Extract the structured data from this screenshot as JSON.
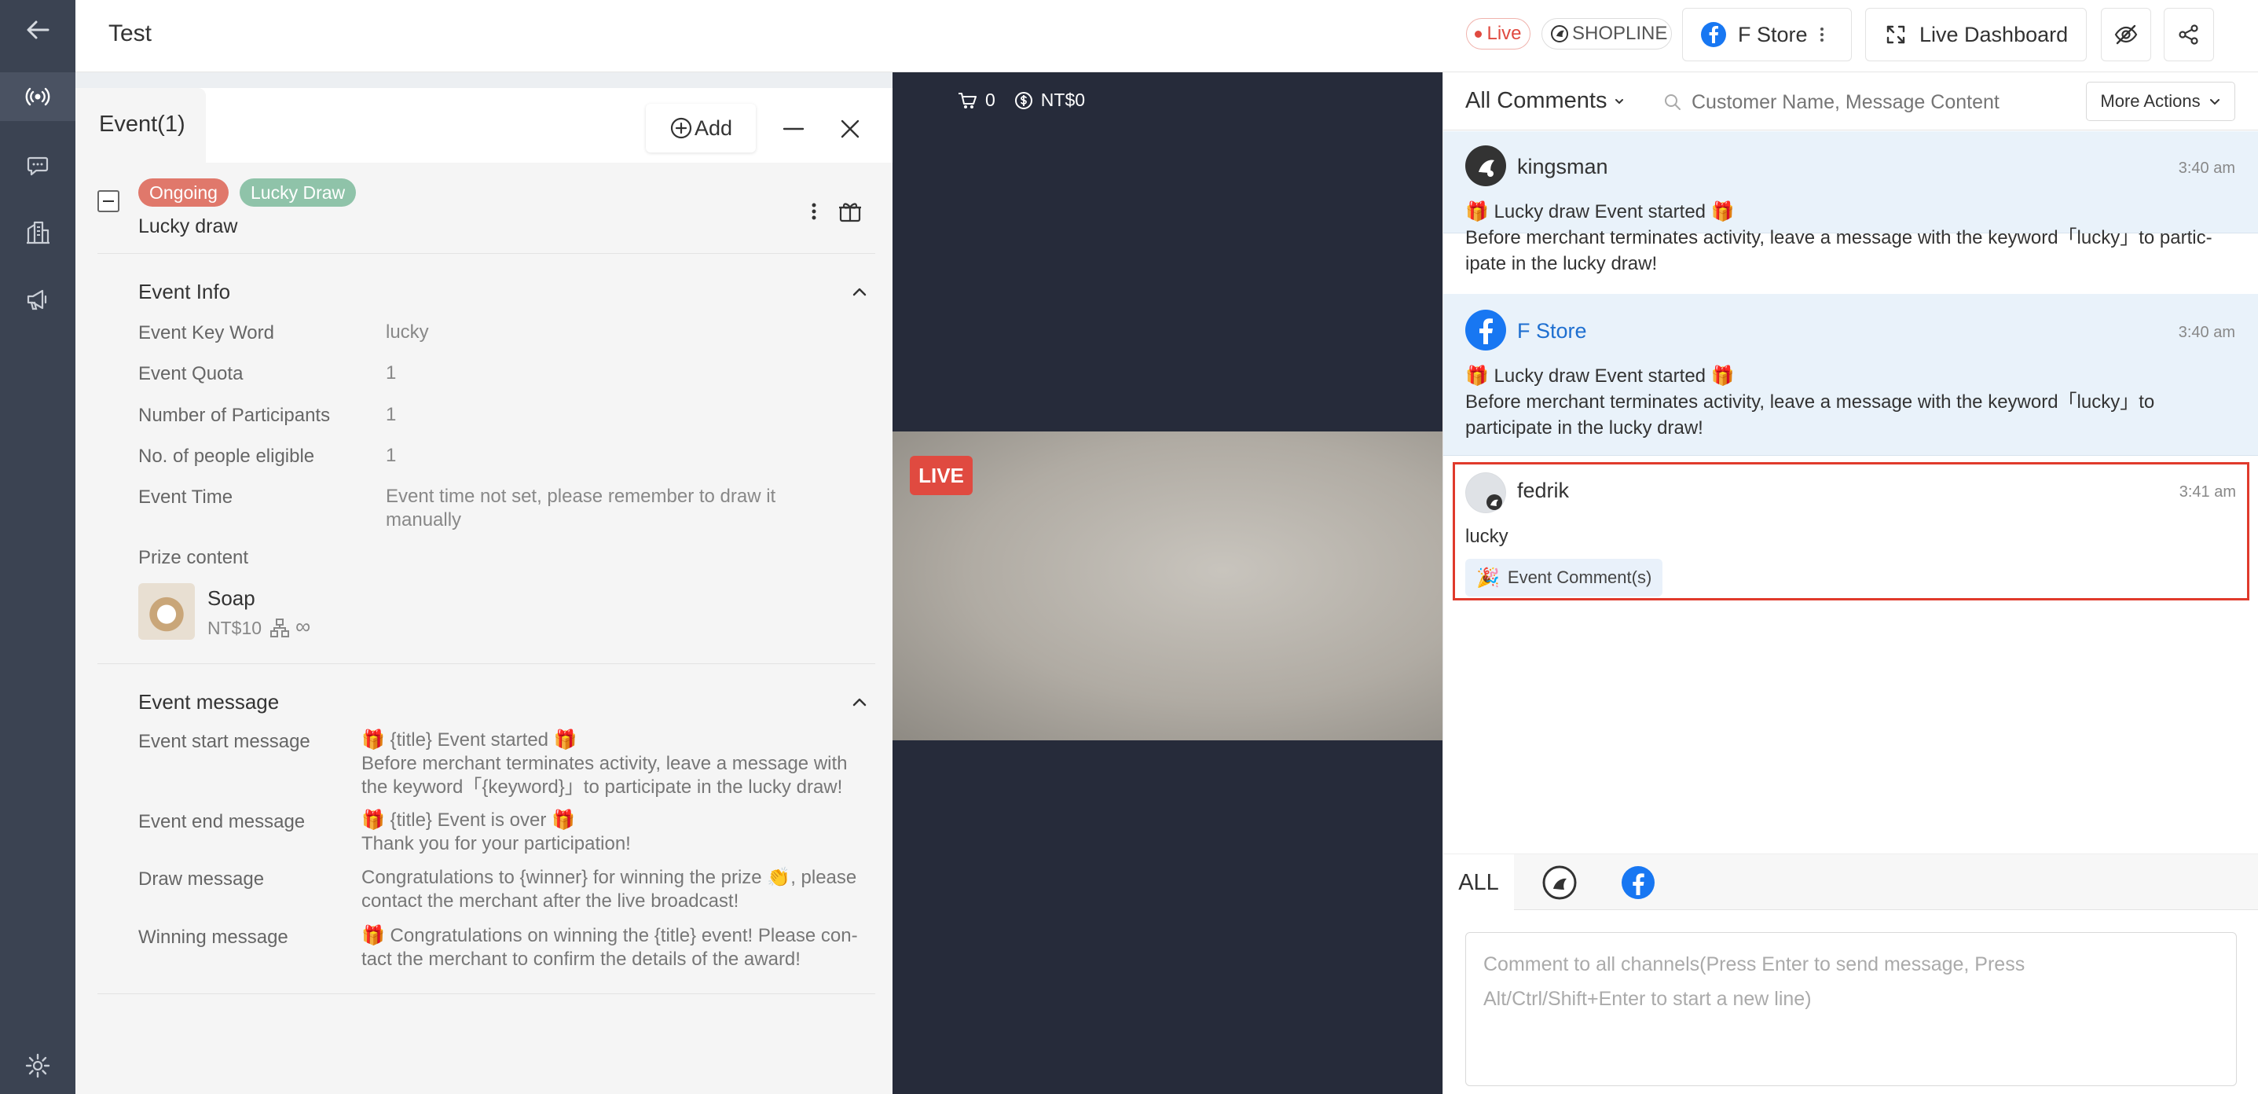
{
  "header": {
    "title": "Test",
    "live_label": "Live",
    "shopline_label": "SHOPLINE",
    "store_name": "F Store",
    "dashboard_label": "Live Dashboard"
  },
  "event_panel": {
    "title": "Event(1)",
    "add_label": "Add",
    "status_tag": "Ongoing",
    "type_tag": "Lucky Draw",
    "event_name": "Lucky draw",
    "info_section_title": "Event Info",
    "info_rows": [
      {
        "label": "Event Key Word",
        "value": "lucky"
      },
      {
        "label": "Event Quota",
        "value": "1"
      },
      {
        "label": "Number of Participants",
        "value": "1"
      },
      {
        "label": "No. of people eligible",
        "value": "1"
      },
      {
        "label": "Event Time",
        "value_line1": "Event time not set, please remember to draw it",
        "value_line2": "manually"
      }
    ],
    "prize_label": "Prize content",
    "prize": {
      "name": "Soap",
      "price": "NT$10",
      "stock": "∞"
    },
    "message_section_title": "Event message",
    "messages": [
      {
        "label": "Event start message",
        "lines": [
          "🎁 {title} Event started 🎁",
          "Before merchant terminates activity, leave a message with",
          "the keyword「{keyword}」to participate in the lucky draw!"
        ]
      },
      {
        "label": "Event end message",
        "lines": [
          "🎁 {title} Event is over 🎁",
          "Thank you for your participation!"
        ]
      },
      {
        "label": "Draw message",
        "lines": [
          "Congratulations to {winner} for winning the prize 👏, please",
          "contact the merchant after the live broadcast!"
        ]
      },
      {
        "label": "Winning message",
        "lines": [
          "🎁 Congratulations on winning the {title} event! Please con-",
          "tact the merchant to confirm the details of the award!"
        ]
      }
    ]
  },
  "video": {
    "cart_count": "0",
    "sales_amount": "NT$0",
    "live_badge": "LIVE"
  },
  "comments_panel": {
    "filter_label": "All Comments",
    "search_placeholder": "Customer Name, Message Content",
    "more_actions_label": "More Actions",
    "comments": [
      {
        "user": "kingsman",
        "time": "3:40 am",
        "lines": [
          "🎁 Lucky draw Event started 🎁",
          "Before merchant terminates activity, leave a message with the keyword「lucky」to partic-",
          "ipate in the lucky draw!"
        ]
      },
      {
        "user": "F Store",
        "time": "3:40 am",
        "lines": [
          "🎁 Lucky draw Event started 🎁",
          "Before merchant terminates activity, leave a message with the keyword「lucky」to",
          "participate in the lucky draw!"
        ]
      },
      {
        "user": "fedrik",
        "time": "3:41 am",
        "lines": [
          "lucky"
        ],
        "badge": "Event Comment(s)"
      }
    ],
    "tabs": {
      "all_label": "ALL"
    },
    "input_placeholder_line1": "Comment to all channels(Press Enter to send message, Press",
    "input_placeholder_line2": "Alt/Ctrl/Shift+Enter to start a new line)"
  },
  "colors": {
    "sidebar": "#3b4352",
    "ongoing_tag": "#e0786b",
    "lucky_tag": "#8fc3a9",
    "facebook_blue": "#1877f2",
    "live_red": "#e04a40",
    "highlight_border": "#e03a2c"
  }
}
